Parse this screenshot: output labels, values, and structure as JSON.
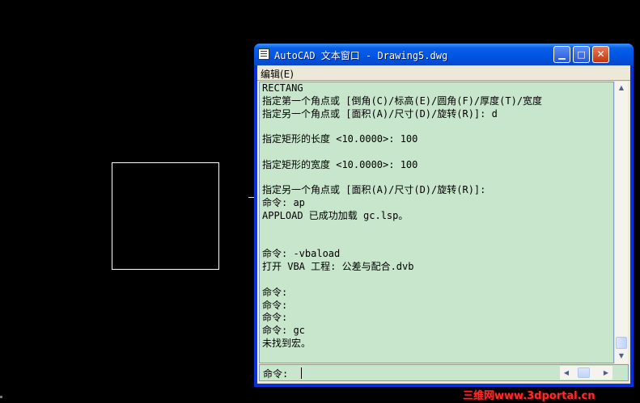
{
  "window": {
    "title": "AutoCAD 文本窗口 - Drawing5.dwg",
    "buttons": {
      "minimize": "▁",
      "maximize": "□",
      "close": "✕"
    }
  },
  "menu": {
    "edit": "编辑(E)"
  },
  "history": [
    "RECTANG",
    "指定第一个角点或 [倒角(C)/标高(E)/圆角(F)/厚度(T)/宽度",
    "指定另一个角点或 [面积(A)/尺寸(D)/旋转(R)]: d",
    "",
    "指定矩形的长度 <10.0000>: 100",
    "",
    "指定矩形的宽度 <10.0000>: 100",
    "",
    "指定另一个角点或 [面积(A)/尺寸(D)/旋转(R)]:",
    "命令: ap",
    "APPLOAD 已成功加载 gc.lsp。",
    "",
    "",
    "命令: -vbaload",
    "打开 VBA 工程: 公差与配合.dvb",
    "",
    "命令:",
    "命令:",
    "命令:",
    "命令: gc",
    "未找到宏。"
  ],
  "command_line": {
    "prompt": "命令:"
  },
  "scroll_icons": {
    "up": "▲",
    "down": "▼",
    "left": "◀",
    "right": "▶"
  },
  "watermark": "三维网www.3dportal.cn"
}
